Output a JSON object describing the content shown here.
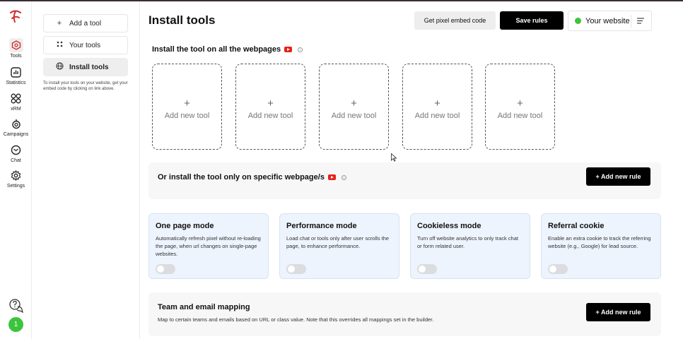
{
  "rail": {
    "items": [
      {
        "label": "Tools",
        "icon": "hexagon-icon",
        "active": true
      },
      {
        "label": "Statistics",
        "icon": "bar-chart-icon"
      },
      {
        "label": "xRM",
        "icon": "grid-icon"
      },
      {
        "label": "Campaigns",
        "icon": "campaign-icon"
      },
      {
        "label": "Chat",
        "icon": "chat-icon"
      },
      {
        "label": "Settings",
        "icon": "gear-icon"
      }
    ],
    "avatar_text": "1"
  },
  "subnav": {
    "items": [
      {
        "label": "Add a tool",
        "icon": "plus-icon"
      },
      {
        "label": "Your tools",
        "icon": "dots-grid-icon"
      },
      {
        "label": "Install tools",
        "icon": "globe-icon",
        "active": true
      }
    ],
    "hint": "To install your tools on your website, get your embed code by clicking on link above."
  },
  "header": {
    "title": "Install tools",
    "embed_label": "Get pixel embed code",
    "save_label": "Save rules",
    "website_label": "Your website",
    "status_color": "#3cc43c"
  },
  "install_all": {
    "title": "Install the tool on all the webpages",
    "cards": [
      {
        "plus": "+",
        "label": "Add new tool"
      },
      {
        "plus": "+",
        "label": "Add new tool"
      },
      {
        "plus": "+",
        "label": "Add new tool"
      },
      {
        "plus": "+",
        "label": "Add new tool"
      },
      {
        "plus": "+",
        "label": "Add new tool"
      }
    ]
  },
  "specific": {
    "title": "Or install the tool only on specific webpage/s",
    "button": "+ Add new rule"
  },
  "modes": [
    {
      "title": "One page mode",
      "desc": "Automatically refresh pixel without re-loading the page, when url changes on single-page websites.",
      "on": false
    },
    {
      "title": "Performance mode",
      "desc": "Load chat or tools only after user scrolls the page, to enhance performance.",
      "on": false
    },
    {
      "title": "Cookieless mode",
      "desc": "Turn off website analytics to only track chat or form related user.",
      "on": false
    },
    {
      "title": "Referral cookie",
      "desc": "Enable an extra cookie to track the referring website (e.g., Google) for lead source.",
      "on": false
    }
  ],
  "team": {
    "title": "Team and email mapping",
    "desc": "Map to certain teams and emails based on URL or class value. Note that this overrides all mappings set in the builder.",
    "button": "+ Add new rule"
  },
  "colors": {
    "accent": "#000000",
    "mode_bg": "#edf4fd",
    "youtube": "#e62117"
  }
}
